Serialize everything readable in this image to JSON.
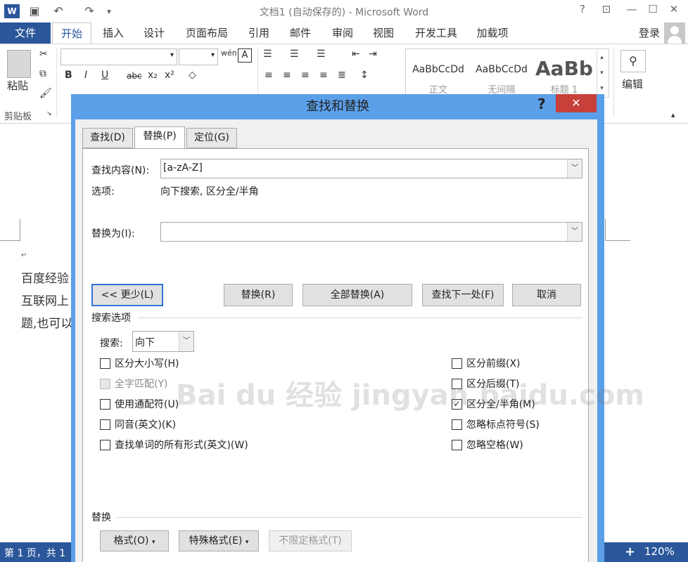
{
  "window": {
    "title": "文档1 (自动保存的) - Microsoft Word",
    "help": "?",
    "qat": {
      "undo": "↶",
      "redo": "↷"
    }
  },
  "tabs": [
    "文件",
    "开始",
    "插入",
    "设计",
    "页面布局",
    "引用",
    "邮件",
    "审阅",
    "视图",
    "开发工具",
    "加载项"
  ],
  "account": {
    "login": "登录"
  },
  "ribbon": {
    "paste_label": "粘贴",
    "clipboard_label": "剪贴板",
    "styles": [
      {
        "preview": "AaBbCcDd",
        "name": "正文"
      },
      {
        "preview": "AaBbCcDd",
        "name": "无间隔"
      },
      {
        "preview": "AaBb",
        "name": "标题 1"
      }
    ],
    "edit_label": "编辑"
  },
  "document": {
    "lines": [
      "百度经验",
      "互联网上",
      "题,也可以"
    ]
  },
  "statusbar": {
    "page": "第 1 页，共 1",
    "zoom": "120%"
  },
  "dialog": {
    "title": "查找和替换",
    "help": "?",
    "tabs": [
      "查找(D)",
      "替换(P)",
      "定位(G)"
    ],
    "find_label": "查找内容(N):",
    "find_value": "[a-zA-Z]",
    "options_label": "选项:",
    "options_value": "向下搜索, 区分全/半角",
    "replace_label": "替换为(I):",
    "replace_value": "",
    "buttons": {
      "less": "<< 更少(L)",
      "replace": "替换(R)",
      "replace_all": "全部替换(A)",
      "find_next": "查找下一处(F)",
      "cancel": "取消"
    },
    "search_options_label": "搜索选项",
    "search_label": "搜索:",
    "search_value": "向下",
    "left_checks": [
      {
        "label": "区分大小写(H)",
        "checked": false,
        "disabled": false
      },
      {
        "label": "全字匹配(Y)",
        "checked": false,
        "disabled": true
      },
      {
        "label": "使用通配符(U)",
        "checked": false,
        "disabled": false
      },
      {
        "label": "同音(英文)(K)",
        "checked": false,
        "disabled": false
      },
      {
        "label": "查找单词的所有形式(英文)(W)",
        "checked": false,
        "disabled": false
      }
    ],
    "right_checks": [
      {
        "label": "区分前缀(X)",
        "checked": false
      },
      {
        "label": "区分后缀(T)",
        "checked": false
      },
      {
        "label": "区分全/半角(M)",
        "checked": true
      },
      {
        "label": "忽略标点符号(S)",
        "checked": false
      },
      {
        "label": "忽略空格(W)",
        "checked": false
      }
    ],
    "replace_section_label": "替换",
    "format_buttons": {
      "format": "格式(O)",
      "special": "特殊格式(E)",
      "no_format": "不限定格式(T)"
    }
  },
  "watermark": "Bai du 经验 jingyan.baidu.com"
}
